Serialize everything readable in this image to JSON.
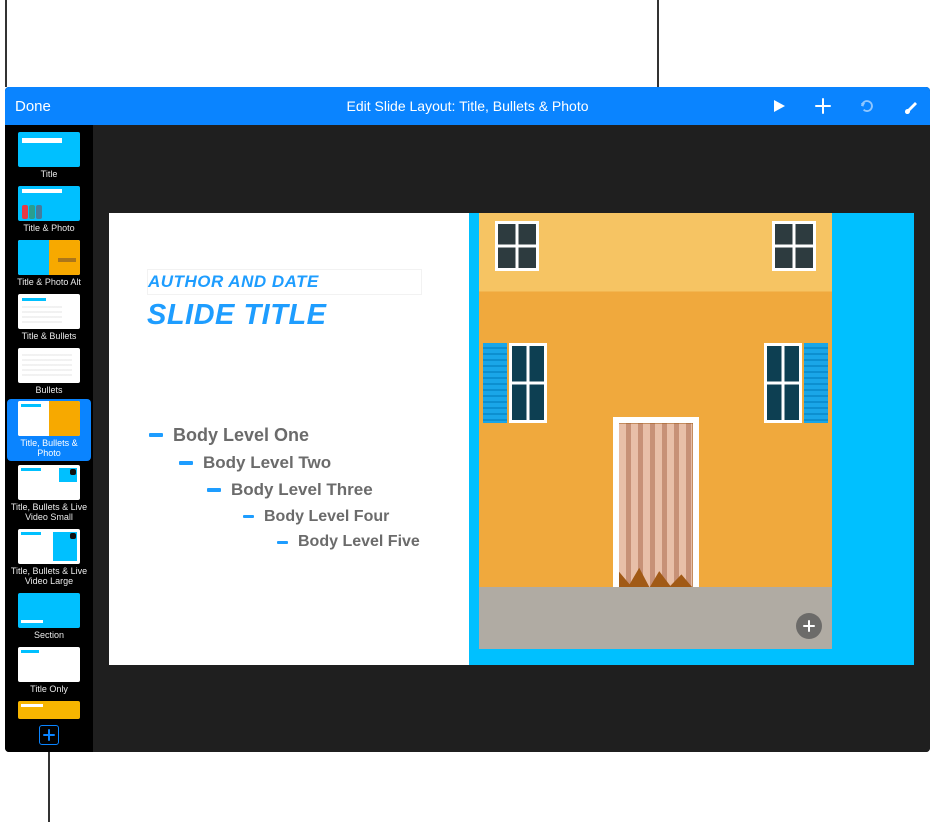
{
  "toolbar": {
    "done_label": "Done",
    "title_prefix": "Edit Slide Layout: ",
    "layout_name": "Title, Bullets & Photo"
  },
  "toolbar_icons": {
    "play": "play-icon",
    "add": "plus-icon",
    "undo": "undo-icon",
    "format": "paintbrush-icon"
  },
  "sidebar": {
    "items": [
      {
        "label": "Title",
        "variant": "th-title"
      },
      {
        "label": "Title & Photo",
        "variant": "th-titlephoto"
      },
      {
        "label": "Title & Photo Alt",
        "variant": "th-titlephotoalt"
      },
      {
        "label": "Title & Bullets",
        "variant": "th-titlebullets"
      },
      {
        "label": "Bullets",
        "variant": "th-bullets"
      },
      {
        "label": "Title, Bullets & Photo",
        "variant": "th-selected",
        "selected": true
      },
      {
        "label": "Title, Bullets & Live Video Small",
        "variant": "th-video-small"
      },
      {
        "label": "Title, Bullets & Live Video Large",
        "variant": "th-video-large"
      },
      {
        "label": "Section",
        "variant": "th-section"
      },
      {
        "label": "Title Only",
        "variant": "th-titleonly"
      },
      {
        "label": "",
        "variant": "th-agenda"
      }
    ],
    "add_label": "+"
  },
  "slide": {
    "author_placeholder": "AUTHOR AND DATE",
    "title_placeholder": "SLIDE TITLE",
    "bullets": [
      "Body Level One",
      "Body Level Two",
      "Body Level Three",
      "Body Level Four",
      "Body Level Five"
    ]
  },
  "colors": {
    "toolbar_bg": "#0a84ff",
    "accent": "#1e9dff",
    "canvas_bg": "#1f1f1f",
    "photo_bg": "#00c0ff"
  }
}
